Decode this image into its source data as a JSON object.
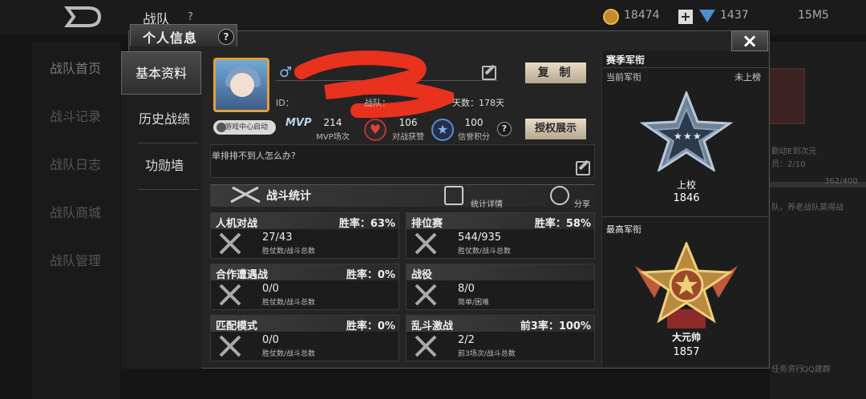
{
  "background": {
    "title": "战队",
    "help_glyph": "?",
    "coins": "18474",
    "gems": "1437",
    "extra": "15M5",
    "sidebar": [
      "战队首页",
      "战斗记录",
      "战队日志",
      "战队商城",
      "战队管理"
    ],
    "right_texts": [
      "勤动E到次元",
      "员：2/10",
      "362/400",
      "队，养老战队莫得战",
      "任务资行",
      "QQ建群"
    ]
  },
  "modal": {
    "tab_title": "个人信息",
    "help_glyph": "?",
    "close_glyph": "×",
    "menu": [
      "基本资料",
      "历史战绩",
      "功勋墙"
    ]
  },
  "profile": {
    "gender_glyph": "♂",
    "copy_label": "复 制",
    "id_label": "ID：",
    "team_label": "战队：",
    "days_label": "天数：178天",
    "game_center": "游戏中心启动",
    "mvp_label": "MVP",
    "stats": [
      {
        "value": "214",
        "label": "MVP场次"
      },
      {
        "value": "106",
        "label": "对战获赞"
      },
      {
        "value": "100",
        "label": "信誉积分"
      }
    ],
    "auth_label": "授权展示",
    "signature": "单排排不到人怎么办?"
  },
  "battle": {
    "title": "战斗统计",
    "detail_label": "统计详情",
    "share_label": "分享",
    "cards": [
      {
        "name": "人机对战",
        "rate": "胜率：63%",
        "value": "27/43",
        "desc": "胜仗数/战斗总数"
      },
      {
        "name": "排位赛",
        "rate": "胜率：58%",
        "value": "544/935",
        "desc": "胜仗数/战斗总数"
      },
      {
        "name": "合作遭遇战",
        "rate": "胜率：0%",
        "value": "0/0",
        "desc": "胜仗数/战斗总数"
      },
      {
        "name": "战役",
        "rate": "",
        "value": "8/0",
        "desc": "简单/困难"
      },
      {
        "name": "匹配模式",
        "rate": "胜率：0%",
        "value": "0/0",
        "desc": "胜仗数/战斗总数"
      },
      {
        "name": "乱斗激战",
        "rate": "前3率：100%",
        "value": "2/2",
        "desc": "前3场次/战斗总数"
      }
    ]
  },
  "rank": {
    "season_title": "赛季军衔",
    "current_label": "当前军衔",
    "current_status": "未上榜",
    "current_name": "上校",
    "current_score": "1846",
    "highest_title": "最高军衔",
    "highest_name": "大元帅",
    "highest_score": "1857"
  },
  "colors": {
    "accent_gold": "#e0a03a",
    "button_beige": "#d6cab4",
    "panel_dark": "#242424"
  }
}
